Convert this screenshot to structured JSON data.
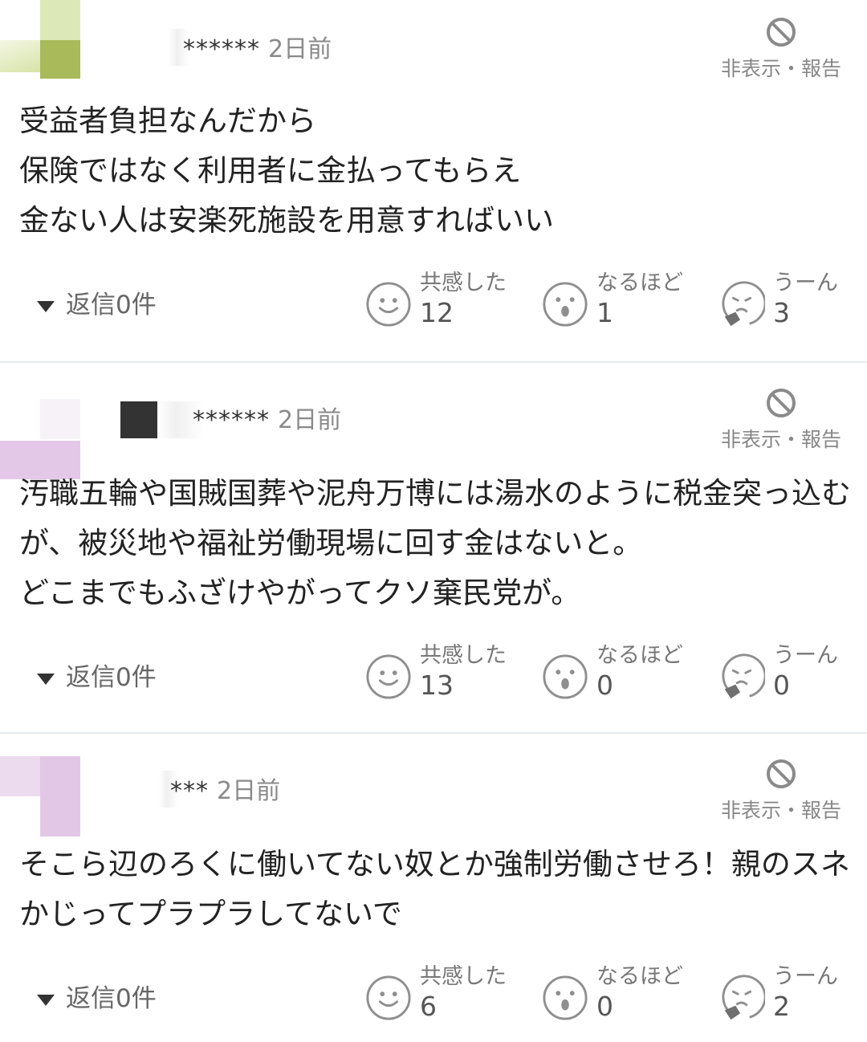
{
  "colors": {
    "text": "#222222",
    "muted": "#888888",
    "divider": "#e6eaee",
    "icon": "#8a8a8a"
  },
  "comments": [
    {
      "user_masked": "******",
      "time": "2日前",
      "hide_report": "非表示・報告",
      "body": "受益者負担なんだから\n保険ではなく利用者に金払ってもらえ\n金ない人は安楽死施設を用意すればいい",
      "reply": "返信0件",
      "reactions": [
        {
          "label": "共感した",
          "count": "12",
          "icon": "smile-face-icon"
        },
        {
          "label": "なるほど",
          "count": "1",
          "icon": "surprised-face-icon"
        },
        {
          "label": "うーん",
          "count": "3",
          "icon": "thinking-face-icon"
        }
      ]
    },
    {
      "user_masked": "******",
      "time": "2日前",
      "hide_report": "非表示・報告",
      "body": "汚職五輪や国賊国葬や泥舟万博には湯水のように税金突っ込むが、被災地や福祉労働現場に回す金はないと。\nどこまでもふざけやがってクソ棄民党が。",
      "reply": "返信0件",
      "reactions": [
        {
          "label": "共感した",
          "count": "13",
          "icon": "smile-face-icon"
        },
        {
          "label": "なるほど",
          "count": "0",
          "icon": "surprised-face-icon"
        },
        {
          "label": "うーん",
          "count": "0",
          "icon": "thinking-face-icon"
        }
      ]
    },
    {
      "user_masked": "***",
      "time": "2日前",
      "hide_report": "非表示・報告",
      "body": "そこら辺のろくに働いてない奴とか強制労働させろ！親のスネかじってプラプラしてないで",
      "reply": "返信0件",
      "reactions": [
        {
          "label": "共感した",
          "count": "6",
          "icon": "smile-face-icon"
        },
        {
          "label": "なるほど",
          "count": "0",
          "icon": "surprised-face-icon"
        },
        {
          "label": "うーん",
          "count": "2",
          "icon": "thinking-face-icon"
        }
      ]
    }
  ]
}
